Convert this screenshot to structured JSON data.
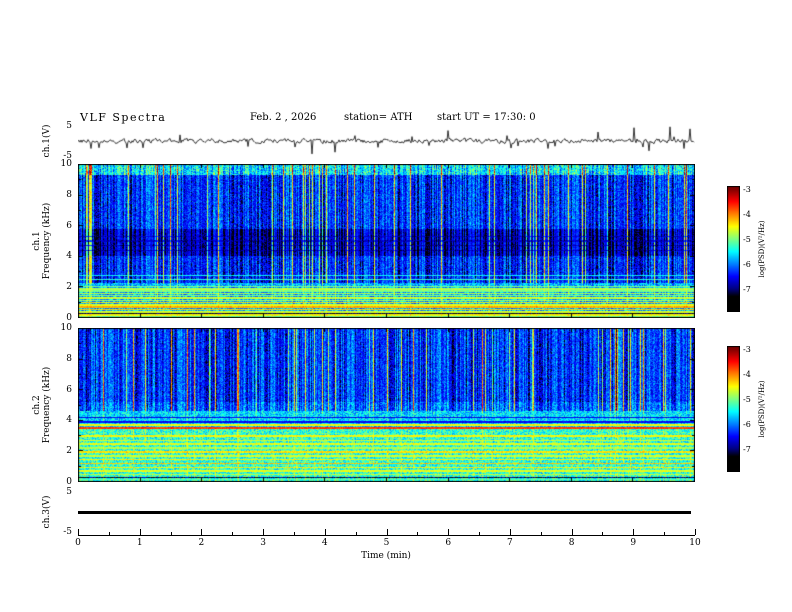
{
  "figure": {
    "background": "#ffffff",
    "plot_text_color": "#000000"
  },
  "header": {
    "title": "VLF Spectra",
    "date": "Feb. 2 , 2026",
    "station": "station= ATH",
    "start_ut": "start UT =  17:30: 0"
  },
  "xaxis": {
    "label": "Time (min)",
    "ticks": [
      0,
      1,
      2,
      3,
      4,
      5,
      6,
      7,
      8,
      9,
      10
    ],
    "range": [
      0,
      10
    ]
  },
  "chart_data": [
    {
      "type": "line",
      "name": "ch.1 time series",
      "ylabel": "ch.1(V)",
      "ylim": [
        -5,
        5
      ],
      "yticks": [
        5,
        -5
      ],
      "x_range": [
        0,
        10
      ],
      "line_color": "#000000",
      "description": "Broadband VLF amplitude: near-zero baseline with small noise, frequent small impulsive sferic spikes, several large spikes (up to ±5 V) near 8-10 min."
    },
    {
      "type": "heatmap",
      "name": "ch.1 spectrogram",
      "channel": "ch.1",
      "ylabel": "Frequency (kHz)",
      "ylim": [
        0,
        10
      ],
      "yticks": [
        0,
        2,
        4,
        6,
        8,
        10
      ],
      "xlim": [
        0,
        10
      ],
      "colormap": "jet",
      "colorbar": {
        "label": "log(PSD)(V²/Hz)",
        "ticks": [
          -3,
          -4,
          -5,
          -6,
          -7
        ],
        "range": [
          -7,
          -3
        ]
      },
      "features": {
        "streak_cutoff_khz": 2.3,
        "streak_weak": 0.3,
        "vertical_streaks": "dense impulsive sferic streaks spanning 2-10 kHz across full 0-10 min",
        "bands": [
          {
            "range": [
              9.3,
              10
            ],
            "level": 0.36,
            "noise": 0.14
          },
          {
            "range": [
              5.8,
              9.3
            ],
            "level": 0.17,
            "noise": 0.09
          },
          {
            "range": [
              4.0,
              5.8
            ],
            "level": 0.08,
            "noise": 0.05
          },
          {
            "range": [
              2.3,
              4.0
            ],
            "level": 0.16,
            "noise": 0.09
          },
          {
            "range": [
              0,
              2.3
            ],
            "level": 0.3,
            "noise": 0.12
          }
        ],
        "lines": [
          {
            "f": 5.3,
            "v": 0.06,
            "w": 0.04
          },
          {
            "f": 5.0,
            "v": 0.06,
            "w": 0.04
          },
          {
            "f": 4.7,
            "v": 0.05,
            "w": 0.04
          },
          {
            "f": 4.4,
            "v": 0.05,
            "w": 0.04
          },
          {
            "f": 2.75,
            "v": 0.38,
            "w": 0.05
          },
          {
            "f": 2.5,
            "v": 0.42,
            "w": 0.05
          },
          {
            "f": 2.05,
            "v": 0.5,
            "w": 0.05
          },
          {
            "f": 1.9,
            "v": 0.55,
            "w": 0.05
          },
          {
            "f": 1.75,
            "v": 0.5,
            "w": 0.05
          },
          {
            "f": 1.6,
            "v": 0.56,
            "w": 0.05
          },
          {
            "f": 1.45,
            "v": 0.52,
            "w": 0.05
          },
          {
            "f": 1.3,
            "v": 0.58,
            "w": 0.05
          },
          {
            "f": 1.15,
            "v": 0.55,
            "w": 0.05
          },
          {
            "f": 1.0,
            "v": 0.65,
            "w": 0.05
          },
          {
            "f": 0.85,
            "v": 0.6,
            "w": 0.05
          },
          {
            "f": 0.7,
            "v": 0.7,
            "w": 0.06
          },
          {
            "f": 0.55,
            "v": 0.66,
            "w": 0.05
          },
          {
            "f": 0.4,
            "v": 0.58,
            "w": 0.05
          },
          {
            "f": 0.3,
            "v": 0.01,
            "w": 0.04
          },
          {
            "f": 0.18,
            "v": 0.62,
            "w": 0.05
          },
          {
            "f": 0.08,
            "v": 0.48,
            "w": 0.05
          }
        ]
      }
    },
    {
      "type": "heatmap",
      "name": "ch.2 spectrogram",
      "channel": "ch.2",
      "ylabel": "Frequency (kHz)",
      "ylim": [
        0,
        10
      ],
      "yticks": [
        0,
        2,
        4,
        6,
        8,
        10
      ],
      "xlim": [
        0,
        10
      ],
      "colormap": "jet",
      "colorbar": {
        "label": "log(PSD)(V²/Hz)",
        "ticks": [
          -3,
          -4,
          -5,
          -6,
          -7
        ],
        "range": [
          -7,
          -3
        ]
      },
      "features_note": "strong narrowband emission near 3.5 kHz; quasi-harmonic power-line lines below 3 kHz; diffuse green band below ~4.5 kHz; blue sferic-streaked region above 5 kHz",
      "features": {
        "streak_cutoff_khz": 4.6,
        "streak_weak": 0.18,
        "vertical_streaks": "impulsive sferic streaks mainly above 4.6 kHz",
        "bands": [
          {
            "range": [
              5.2,
              10
            ],
            "level": 0.17,
            "noise": 0.09
          },
          {
            "range": [
              4.6,
              5.2
            ],
            "level": 0.22,
            "noise": 0.1
          },
          {
            "range": [
              3.55,
              4.6
            ],
            "level": 0.34,
            "noise": 0.12
          },
          {
            "range": [
              0,
              3.55
            ],
            "level": 0.42,
            "noise": 0.13
          }
        ],
        "lines": [
          {
            "f": 4.2,
            "v": 0.1,
            "w": 0.04
          },
          {
            "f": 3.9,
            "v": 0.12,
            "w": 0.04
          },
          {
            "f": 3.7,
            "v": 0.62,
            "w": 0.04
          },
          {
            "f": 3.5,
            "v": 0.82,
            "w": 0.07
          },
          {
            "f": 3.0,
            "v": 0.62,
            "w": 0.05
          },
          {
            "f": 2.7,
            "v": 0.58,
            "w": 0.05
          },
          {
            "f": 2.45,
            "v": 0.6,
            "w": 0.05
          },
          {
            "f": 2.2,
            "v": 0.55,
            "w": 0.05
          },
          {
            "f": 1.95,
            "v": 0.65,
            "w": 0.05
          },
          {
            "f": 1.7,
            "v": 0.58,
            "w": 0.05
          },
          {
            "f": 1.45,
            "v": 0.62,
            "w": 0.05
          },
          {
            "f": 1.2,
            "v": 0.68,
            "w": 0.05
          },
          {
            "f": 0.95,
            "v": 0.63,
            "w": 0.05
          },
          {
            "f": 0.7,
            "v": 0.6,
            "w": 0.05
          },
          {
            "f": 0.5,
            "v": 0.56,
            "w": 0.05
          },
          {
            "f": 0.3,
            "v": 0.02,
            "w": 0.04
          },
          {
            "f": 0.15,
            "v": 0.45,
            "w": 0.05
          }
        ]
      }
    },
    {
      "type": "line",
      "name": "ch.3 time series",
      "ylabel": "ch.3(V)",
      "ylim": [
        -5,
        5
      ],
      "yticks": [
        5,
        -5
      ],
      "line_color": "#000000",
      "values": "constant 0 V (flat thick black line across 0-9.9 min)"
    }
  ]
}
